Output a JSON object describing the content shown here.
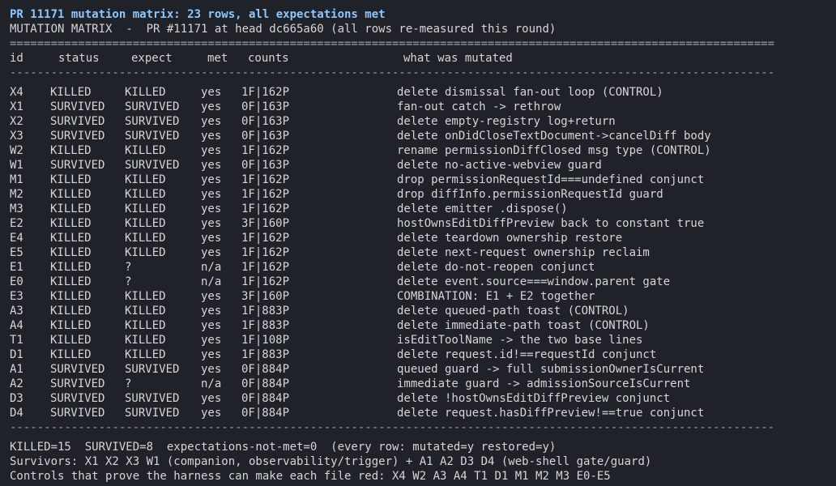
{
  "title": "PR 11171 mutation matrix: 23 rows, all expectations met",
  "subtitle": "MUTATION MATRIX  -  PR #11171 at head dc665a60 (all rows re-measured this round)",
  "rule_double": "=============================================================================================================================",
  "rule_single": "-----------------------------------------------------------------------------------------------------------------------------",
  "headers": {
    "id": "id",
    "status": "status",
    "expect": "expect",
    "met": "met",
    "counts": "counts",
    "what": "what was mutated"
  },
  "rows": [
    {
      "id": "X4",
      "status": "KILLED",
      "expect": "KILLED",
      "met": "yes",
      "counts": "1F|162P",
      "what": "delete dismissal fan-out loop (CONTROL)"
    },
    {
      "id": "X1",
      "status": "SURVIVED",
      "expect": "SURVIVED",
      "met": "yes",
      "counts": "0F|163P",
      "what": "fan-out catch -> rethrow"
    },
    {
      "id": "X2",
      "status": "SURVIVED",
      "expect": "SURVIVED",
      "met": "yes",
      "counts": "0F|163P",
      "what": "delete empty-registry log+return"
    },
    {
      "id": "X3",
      "status": "SURVIVED",
      "expect": "SURVIVED",
      "met": "yes",
      "counts": "0F|163P",
      "what": "delete onDidCloseTextDocument->cancelDiff body"
    },
    {
      "id": "W2",
      "status": "KILLED",
      "expect": "KILLED",
      "met": "yes",
      "counts": "1F|162P",
      "what": "rename permissionDiffClosed msg type (CONTROL)"
    },
    {
      "id": "W1",
      "status": "SURVIVED",
      "expect": "SURVIVED",
      "met": "yes",
      "counts": "0F|163P",
      "what": "delete no-active-webview guard"
    },
    {
      "id": "M1",
      "status": "KILLED",
      "expect": "KILLED",
      "met": "yes",
      "counts": "1F|162P",
      "what": "drop permissionRequestId===undefined conjunct"
    },
    {
      "id": "M2",
      "status": "KILLED",
      "expect": "KILLED",
      "met": "yes",
      "counts": "1F|162P",
      "what": "drop diffInfo.permissionRequestId guard"
    },
    {
      "id": "M3",
      "status": "KILLED",
      "expect": "KILLED",
      "met": "yes",
      "counts": "1F|162P",
      "what": "delete emitter .dispose()"
    },
    {
      "id": "E2",
      "status": "KILLED",
      "expect": "KILLED",
      "met": "yes",
      "counts": "3F|160P",
      "what": "hostOwnsEditDiffPreview back to constant true"
    },
    {
      "id": "E4",
      "status": "KILLED",
      "expect": "KILLED",
      "met": "yes",
      "counts": "1F|162P",
      "what": "delete teardown ownership restore"
    },
    {
      "id": "E5",
      "status": "KILLED",
      "expect": "KILLED",
      "met": "yes",
      "counts": "1F|162P",
      "what": "delete next-request ownership reclaim"
    },
    {
      "id": "E1",
      "status": "KILLED",
      "expect": "?",
      "met": "n/a",
      "counts": "1F|162P",
      "what": "delete do-not-reopen conjunct"
    },
    {
      "id": "E0",
      "status": "KILLED",
      "expect": "?",
      "met": "n/a",
      "counts": "1F|162P",
      "what": "delete event.source===window.parent gate"
    },
    {
      "id": "E3",
      "status": "KILLED",
      "expect": "KILLED",
      "met": "yes",
      "counts": "3F|160P",
      "what": "COMBINATION: E1 + E2 together"
    },
    {
      "id": "A3",
      "status": "KILLED",
      "expect": "KILLED",
      "met": "yes",
      "counts": "1F|883P",
      "what": "delete queued-path toast (CONTROL)"
    },
    {
      "id": "A4",
      "status": "KILLED",
      "expect": "KILLED",
      "met": "yes",
      "counts": "1F|883P",
      "what": "delete immediate-path toast (CONTROL)"
    },
    {
      "id": "T1",
      "status": "KILLED",
      "expect": "KILLED",
      "met": "yes",
      "counts": "1F|108P",
      "what": "isEditToolName -> the two base lines"
    },
    {
      "id": "D1",
      "status": "KILLED",
      "expect": "KILLED",
      "met": "yes",
      "counts": "1F|883P",
      "what": "delete request.id!==requestId conjunct"
    },
    {
      "id": "A1",
      "status": "SURVIVED",
      "expect": "SURVIVED",
      "met": "yes",
      "counts": "0F|884P",
      "what": "queued guard -> full submissionOwnerIsCurrent"
    },
    {
      "id": "A2",
      "status": "SURVIVED",
      "expect": "?",
      "met": "n/a",
      "counts": "0F|884P",
      "what": "immediate guard -> admissionSourceIsCurrent"
    },
    {
      "id": "D3",
      "status": "SURVIVED",
      "expect": "SURVIVED",
      "met": "yes",
      "counts": "0F|884P",
      "what": "delete !hostOwnsEditDiffPreview conjunct"
    },
    {
      "id": "D4",
      "status": "SURVIVED",
      "expect": "SURVIVED",
      "met": "yes",
      "counts": "0F|884P",
      "what": "delete request.hasDiffPreview!==true conjunct"
    }
  ],
  "summary": [
    "KILLED=15  SURVIVED=8  expectations-not-met=0  (every row: mutated=y restored=y)",
    "Survivors: X1 X2 X3 W1 (companion, observability/trigger) + A1 A2 D3 D4 (web-shell gate/guard)",
    "Controls that prove the harness can make each file red: X4 W2 A3 A4 T1 D1 M1 M2 M3 E0-E5"
  ]
}
